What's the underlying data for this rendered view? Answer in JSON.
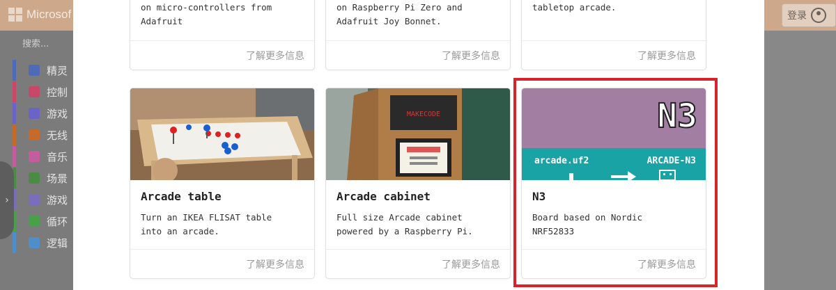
{
  "app": {
    "brand": "Microsof",
    "login_label": "登录",
    "search_placeholder": "搜索...",
    "categories": [
      {
        "label": "精灵",
        "color": "#4f6bb5",
        "icon": "paper-plane-icon"
      },
      {
        "label": "控制",
        "color": "#c9486a",
        "icon": "gamepad-icon"
      },
      {
        "label": "游戏",
        "color": "#6c63c7",
        "icon": "circle-icon"
      },
      {
        "label": "无线",
        "color": "#c46b2b",
        "icon": "signal-icon"
      },
      {
        "label": "音乐",
        "color": "#c45d9d",
        "icon": "headphones-icon"
      },
      {
        "label": "场景",
        "color": "#4c8b45",
        "icon": "tree-icon"
      },
      {
        "label": "游戏",
        "color": "#7b6dbb",
        "icon": "id-card-icon"
      },
      {
        "label": "循环",
        "color": "#4aa04a",
        "icon": "loop-icon"
      },
      {
        "label": "逻辑",
        "color": "#4f8ec9",
        "icon": "shuffle-icon"
      }
    ]
  },
  "cards_top": [
    {
      "desc": "on micro-controllers from\nAdafruit",
      "more": "了解更多信息"
    },
    {
      "desc": "on Raspberry Pi Zero and\nAdafruit Joy Bonnet.",
      "more": "了解更多信息"
    },
    {
      "desc": "tabletop arcade.",
      "more": "了解更多信息"
    }
  ],
  "cards_bottom": [
    {
      "title": "Arcade table",
      "desc": "Turn an IKEA FLISAT table\ninto an arcade.",
      "more": "了解更多信息"
    },
    {
      "title": "Arcade cabinet",
      "desc": "Full size Arcade cabinet\npowered by a Raspberry Pi.",
      "more": "了解更多信息"
    },
    {
      "title": "N3",
      "desc": "Board based on Nordic\nNRF52833",
      "more": "了解更多信息",
      "image_text": {
        "logo": "N3",
        "left": "arcade.uf2",
        "right": "ARCADE-N3"
      }
    }
  ],
  "colors": {
    "highlight": "#d9232a",
    "n3_top": "#a27ea2",
    "n3_band": "#1aa3a5"
  }
}
